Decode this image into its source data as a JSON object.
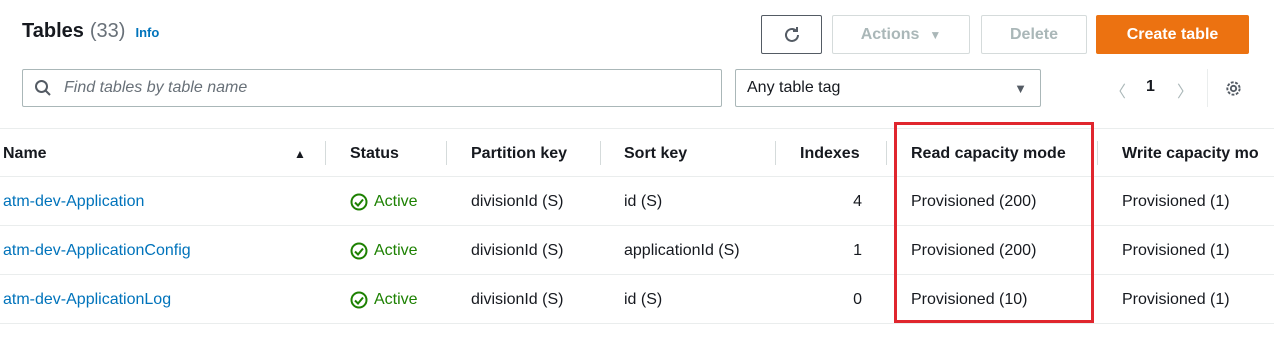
{
  "header": {
    "title": "Tables",
    "count": "(33)",
    "info_label": "Info"
  },
  "toolbar": {
    "refresh_icon": "refresh-icon",
    "actions_label": "Actions",
    "delete_label": "Delete",
    "create_label": "Create table"
  },
  "filter": {
    "search_placeholder": "Find tables by table name",
    "tag_select_value": "Any table tag"
  },
  "pagination": {
    "current_page": "1"
  },
  "colors": {
    "primary_orange": "#ec7211",
    "link_blue": "#0073bb",
    "active_green": "#1d8102",
    "highlight_red": "#e0262e"
  },
  "table": {
    "columns": [
      "Name",
      "Status",
      "Partition key",
      "Sort key",
      "Indexes",
      "Read capacity mode",
      "Write capacity mo"
    ],
    "rows": [
      {
        "name": "atm-dev-Application",
        "status": "Active",
        "partition_key": "divisionId (S)",
        "sort_key": "id (S)",
        "indexes": "4",
        "read_capacity": "Provisioned (200)",
        "write_capacity": "Provisioned (1)"
      },
      {
        "name": "atm-dev-ApplicationConfig",
        "status": "Active",
        "partition_key": "divisionId (S)",
        "sort_key": "applicationId (S)",
        "indexes": "1",
        "read_capacity": "Provisioned (200)",
        "write_capacity": "Provisioned (1)"
      },
      {
        "name": "atm-dev-ApplicationLog",
        "status": "Active",
        "partition_key": "divisionId (S)",
        "sort_key": "id (S)",
        "indexes": "0",
        "read_capacity": "Provisioned (10)",
        "write_capacity": "Provisioned (1)"
      }
    ]
  }
}
